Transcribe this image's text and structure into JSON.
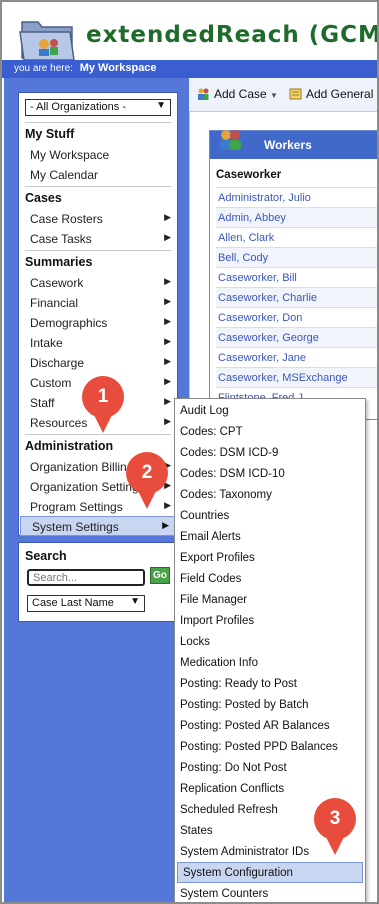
{
  "header": {
    "app_title": "extendedReach (GCM)",
    "breadcrumb_prefix": "you are here:",
    "breadcrumb_current": "My Workspace"
  },
  "sidebar": {
    "org_select": "- All Organizations -",
    "sections": [
      {
        "title": "My Stuff",
        "items": [
          "My Workspace",
          "My Calendar"
        ]
      },
      {
        "title": "Cases",
        "items": [
          "Case Rosters",
          "Case Tasks"
        ]
      },
      {
        "title": "Summaries",
        "items": [
          "Casework",
          "Financial",
          "Demographics",
          "Intake",
          "Discharge",
          "Custom",
          "Staff",
          "Resources"
        ]
      },
      {
        "title": "Administration",
        "items": [
          "Organization Billing",
          "Organization Settings",
          "Program Settings",
          "System Settings"
        ]
      }
    ]
  },
  "search": {
    "title": "Search",
    "placeholder": "Search...",
    "go_label": "Go",
    "sort_select": "Case Last Name"
  },
  "toolbar": {
    "add_case": "Add Case",
    "add_general": "Add General"
  },
  "workers": {
    "title": "Workers",
    "column": "Caseworker",
    "rows": [
      "Administrator, Julio",
      "Admin, Abbey",
      "Allen, Clark",
      "Bell, Cody",
      "Caseworker, Bill",
      "Caseworker, Charlie",
      "Caseworker, Don",
      "Caseworker, George",
      "Caseworker, Jane",
      "Caseworker, MSExchange",
      "Flintstone, Fred J"
    ]
  },
  "flyout": {
    "items": [
      "Audit Log",
      "Codes: CPT",
      "Codes: DSM ICD-9",
      "Codes: DSM ICD-10",
      "Codes: Taxonomy",
      "Countries",
      "Email Alerts",
      "Export Profiles",
      "Field Codes",
      "File Manager",
      "Import Profiles",
      "Locks",
      "Medication Info",
      "Posting: Ready to Post",
      "Posting: Posted by Batch",
      "Posting: Posted AR Balances",
      "Posting: Posted PPD Balances",
      "Posting: Do Not Post",
      "Replication Conflicts",
      "Scheduled Refresh",
      "States",
      "System Administrator IDs",
      "System Configuration",
      "System Counters"
    ],
    "active_item": "System Configuration"
  },
  "callouts": [
    "1",
    "2",
    "3"
  ],
  "colors": {
    "title_green": "#1f6b2b",
    "sidebar_blue": "#5578d8",
    "callout_red": "#e74c3c",
    "highlight": "#c9d6f2"
  }
}
